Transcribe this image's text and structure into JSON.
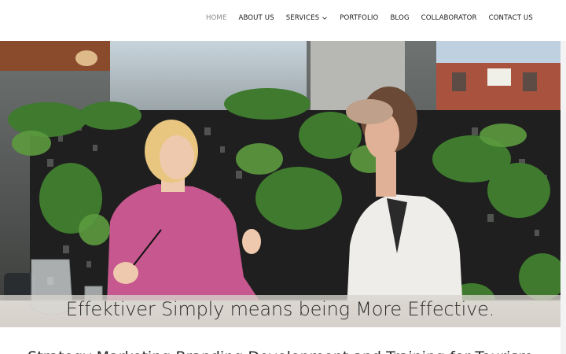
{
  "nav": {
    "items": [
      {
        "label": "HOME",
        "active": true
      },
      {
        "label": "ABOUT US"
      },
      {
        "label": "SERVICES",
        "has_dropdown": true
      },
      {
        "label": "PORTFOLIO"
      },
      {
        "label": "BLOG"
      },
      {
        "label": "COLLABORATOR"
      },
      {
        "label": "CONTACT US"
      }
    ]
  },
  "hero": {
    "caption": "Effektiver Simply means being More Effective."
  },
  "section": {
    "heading_partial": "Strategy Marketing Branding Development and Training for Tourism"
  },
  "colors": {
    "nav_text": "#1a1a1a",
    "nav_active": "#8a8a8a",
    "caption_band": "#d7d4cd"
  }
}
